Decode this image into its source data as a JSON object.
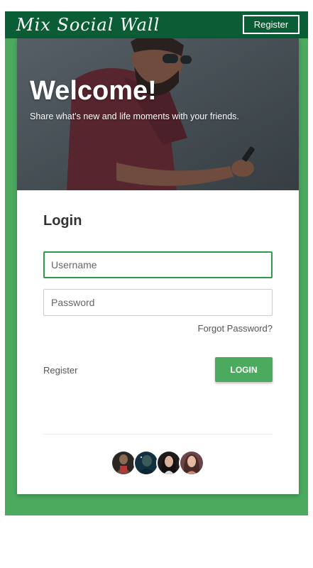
{
  "navbar": {
    "brand": "Mix Social Wall",
    "register_label": "Register"
  },
  "hero": {
    "title": "Welcome!",
    "subtitle": "Share what's new and life moments with your friends."
  },
  "login": {
    "title": "Login",
    "username_placeholder": "Username",
    "password_placeholder": "Password",
    "forgot_label": "Forgot Password?",
    "register_label": "Register",
    "login_label": "LOGIN"
  },
  "colors": {
    "brand_dark": "#0b5d35",
    "brand_green": "#4caa5f",
    "focus_border": "#2f9a4b"
  },
  "avatars": [
    {
      "name": "avatar-1",
      "color": "#3a2a22"
    },
    {
      "name": "avatar-2",
      "color": "#1c3b48"
    },
    {
      "name": "avatar-3",
      "color": "#2a2226"
    },
    {
      "name": "avatar-4",
      "color": "#5a3a3a"
    }
  ]
}
